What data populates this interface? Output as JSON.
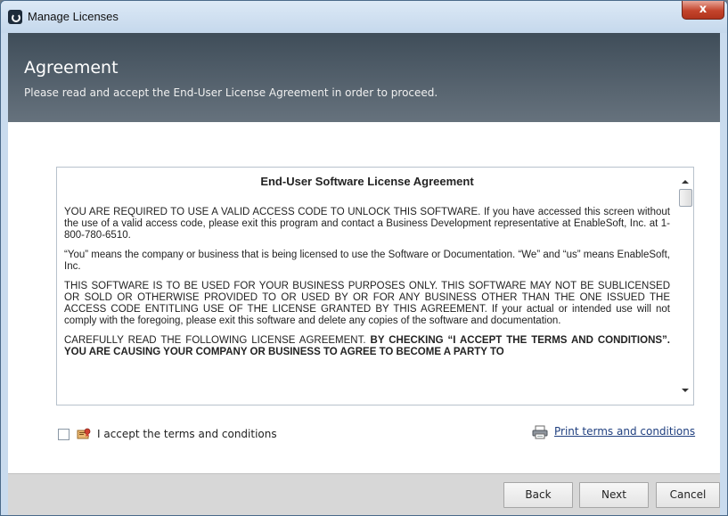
{
  "window": {
    "title": "Manage Licenses",
    "close_label": "x"
  },
  "header": {
    "title": "Agreement",
    "subtitle": "Please read and accept the End-User License Agreement in order to proceed."
  },
  "eula": {
    "title": "End-User Software License Agreement",
    "paragraphs": [
      "YOU ARE REQUIRED TO USE A VALID ACCESS CODE TO UNLOCK THIS SOFTWARE. If you have accessed this screen without the use of a valid access code, please exit this program and contact a Business Development representative at EnableSoft, Inc. at 1-800-780-6510.",
      "“You” means the company or business that is being licensed to use the Software or Documentation.  “We” and “us” means EnableSoft, Inc.",
      "THIS SOFTWARE IS TO BE USED FOR YOUR BUSINESS PURPOSES ONLY.  THIS SOFTWARE MAY NOT BE SUBLICENSED OR SOLD OR OTHERWISE PROVIDED TO OR USED BY OR FOR ANY BUSINESS OTHER THAN THE ONE ISSUED THE ACCESS CODE ENTITLING USE OF THE LICENSE GRANTED BY THIS AGREEMENT.  If your actual or intended use will not comply with the foregoing, please exit this software and delete any copies of the software and documentation."
    ],
    "last_paragraph_normal": "CAREFULLY READ THE FOLLOWING LICENSE AGREEMENT. ",
    "last_paragraph_bold": "BY CHECKING “I ACCEPT THE TERMS AND CONDITIONS”. YOU ARE CAUSING YOUR COMPANY OR BUSINESS TO AGREE TO BECOME A PARTY TO"
  },
  "accept": {
    "label": "I accept the terms and conditions",
    "checked": false
  },
  "print": {
    "label": "Print terms and conditions"
  },
  "footer": {
    "back_label": "Back",
    "next_label": "Next",
    "cancel_label": "Cancel"
  },
  "icons": {
    "app": "app-logo-icon",
    "certificate": "certificate-icon",
    "printer": "printer-icon"
  },
  "colors": {
    "header_bg": "#4f5c68",
    "link": "#1f3f7f",
    "close_button": "#c3442c"
  }
}
